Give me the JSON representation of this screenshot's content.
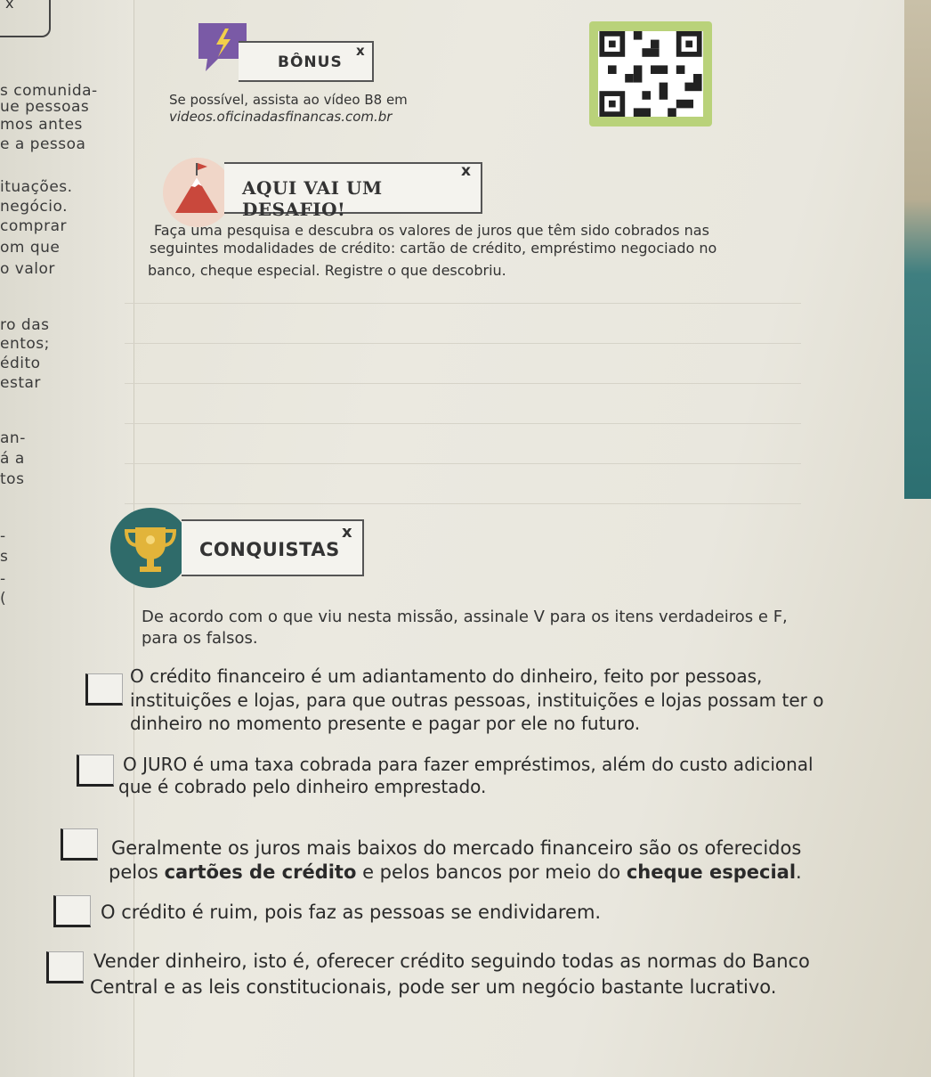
{
  "prev_page_fragments": [
    "s comunida-",
    "ue pessoas",
    "mos antes",
    "e a pessoa",
    "ituações.",
    "negócio.",
    "comprar",
    "om que",
    "o valor",
    "ro das",
    "entos;",
    "édito",
    "estar",
    "an-",
    "á a",
    "tos",
    "-",
    "s",
    "-",
    "("
  ],
  "bonus": {
    "title": "BÔNUS",
    "close": "x",
    "line1": "Se possível, assista ao vídeo B8 em",
    "line2": "videos.oficinadasfinancas.com.br"
  },
  "challenge": {
    "title": "AQUI VAI UM DESAFIO!",
    "close": "x",
    "lines": [
      "Faça uma pesquisa e descubra os valores de juros que têm sido cobrados nas",
      "seguintes modalidades de crédito: cartão de crédito, empréstimo negociado no",
      "banco, cheque especial. Registre o que descobriu."
    ]
  },
  "achievements": {
    "title": "CONQUISTAS",
    "close": "x",
    "intro": [
      "De acordo com o que viu nesta missão, assinale V para os itens verdadeiros e F,",
      "para os falsos."
    ],
    "items": [
      {
        "lines": [
          "O crédito financeiro é um adiantamento do dinheiro, feito por pessoas,",
          "instituições e lojas, para que outras pessoas, instituições e lojas possam ter o",
          "dinheiro no momento presente e pagar por ele no futuro."
        ]
      },
      {
        "lines": [
          "O JURO é uma taxa cobrada para fazer empréstimos, além do custo adicional",
          "que é cobrado pelo dinheiro emprestado."
        ]
      },
      {
        "line1": "Geralmente os juros mais baixos do mercado financeiro são os oferecidos",
        "line2_a": "pelos ",
        "line2_b": "cartões de crédito",
        "line2_c": " e pelos bancos por meio do ",
        "line2_d": "cheque especial",
        "line2_e": "."
      },
      {
        "lines": [
          "O crédito é ruim, pois faz as pessoas se endividarem."
        ]
      },
      {
        "lines": [
          "Vender dinheiro, isto é, oferecer crédito seguindo todas as normas do Banco",
          "Central e as leis constitucionais, pode ser um negócio bastante lucrativo."
        ]
      }
    ]
  },
  "colors": {
    "bonus_icon": "#7a5aa6",
    "challenge_icon": "#f0d6c8",
    "trophy_circle": "#2f6b6a",
    "trophy": "#e2b43a",
    "qr_frame": "#b9d27a"
  }
}
